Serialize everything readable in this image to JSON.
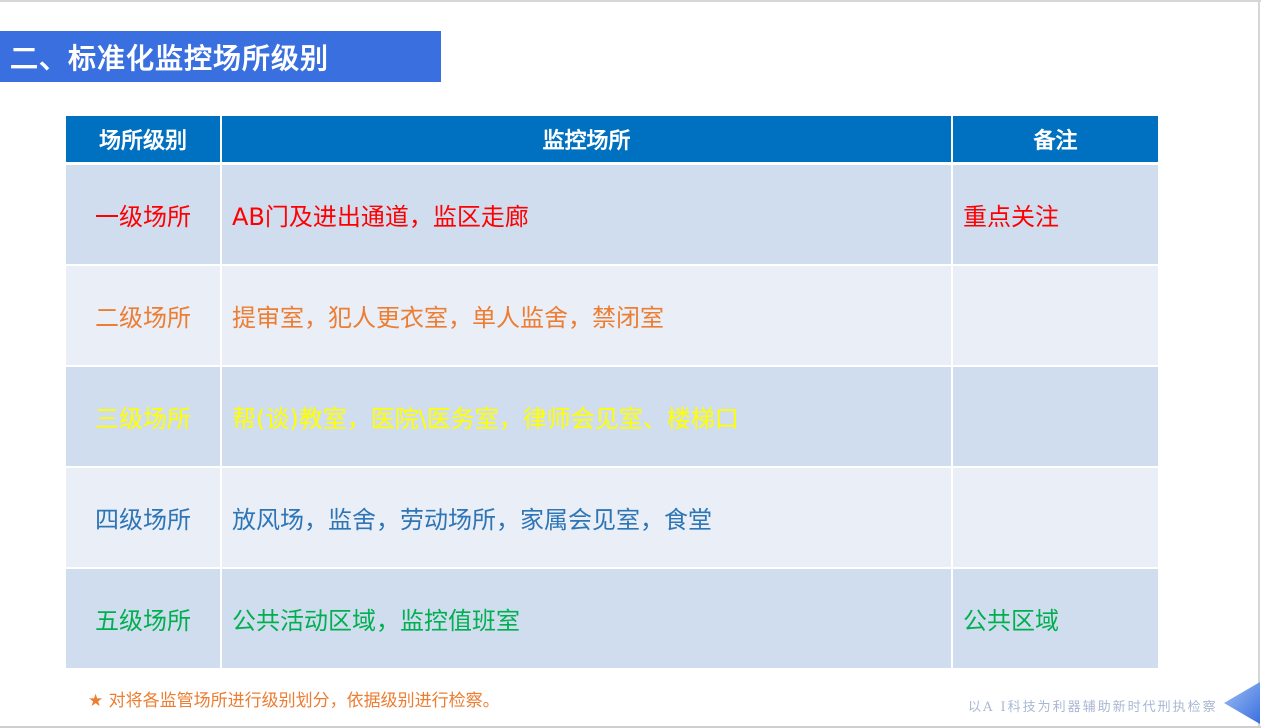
{
  "slide": {
    "title": "二、标准化监控场所级别",
    "footnote": "★ 对将各监管场所进行级别划分，依据级别进行检察。",
    "slogan": "以A I科技为利器辅助新时代刑执检察"
  },
  "table": {
    "headers": [
      "场所级别",
      "监控场所",
      "备注"
    ],
    "header_bg": "#0070c0",
    "rows": [
      {
        "level": "一级场所",
        "places": "AB门及进出通道，监区走廊",
        "note": "重点关注",
        "color": "#ff0000"
      },
      {
        "level": "二级场所",
        "places": "提审室，犯人更衣室，单人监舍，禁闭室",
        "note": "",
        "color": "#ed7d31"
      },
      {
        "level": "三级场所",
        "places": "帮(谈)教室，医院\\医务室，律师会见室、楼梯口",
        "note": "",
        "color": "#ffff00"
      },
      {
        "level": "四级场所",
        "places": "放风场，监舍，劳动场所，家属会见室，食堂",
        "note": "",
        "color": "#2e75b6"
      },
      {
        "level": "五级场所",
        "places": "公共活动区域，监控值班室",
        "note": "公共区域",
        "color": "#00b050"
      }
    ]
  },
  "colors": {
    "title_bar": "#3a6fe0",
    "row_odd": "#d0ddef",
    "row_even": "#e9eef7",
    "footnote": "#ed7d31"
  },
  "icons": {
    "corner": "triangle-left-icon"
  }
}
